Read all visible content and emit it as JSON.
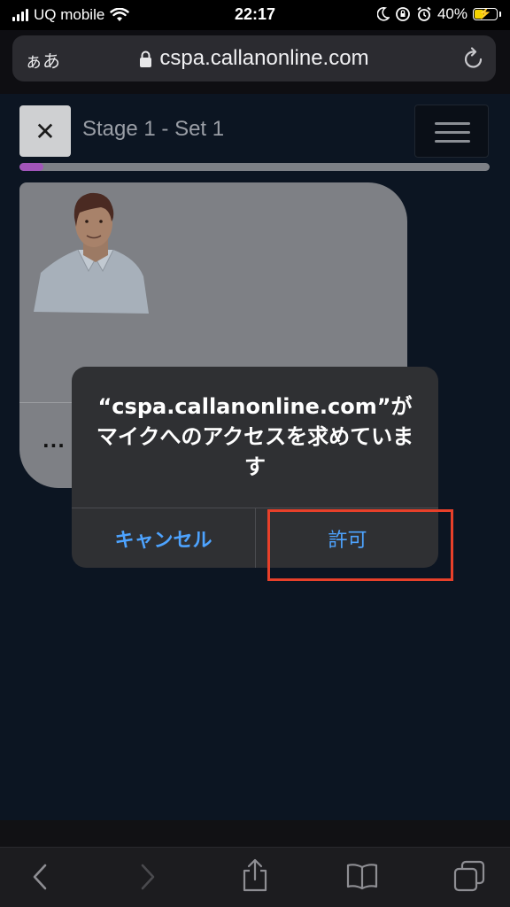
{
  "status_bar": {
    "carrier": "UQ mobile",
    "time": "22:17",
    "battery": "40%",
    "battery_level": 0.4
  },
  "address_bar": {
    "aa_label": "ぁあ",
    "url": "cspa.callanonline.com",
    "icons": [
      "lock-icon",
      "reload-icon"
    ]
  },
  "page": {
    "close_label": "✕",
    "title": "Stage 1 - Set 1",
    "progress": 0.05,
    "card_ellipsis": "..."
  },
  "dialog": {
    "message": "“cspa.callanonline.com”がマイクへのアクセスを求めています",
    "cancel_label": "キャンセル",
    "allow_label": "許可"
  },
  "toolbar": {
    "icons": [
      "back-icon",
      "forward-icon",
      "share-icon",
      "bookmarks-icon",
      "tabs-icon"
    ]
  },
  "colors": {
    "accent_blue": "#4da3ff",
    "progress_purple": "#a155b9",
    "highlight_red": "#e8402a"
  }
}
